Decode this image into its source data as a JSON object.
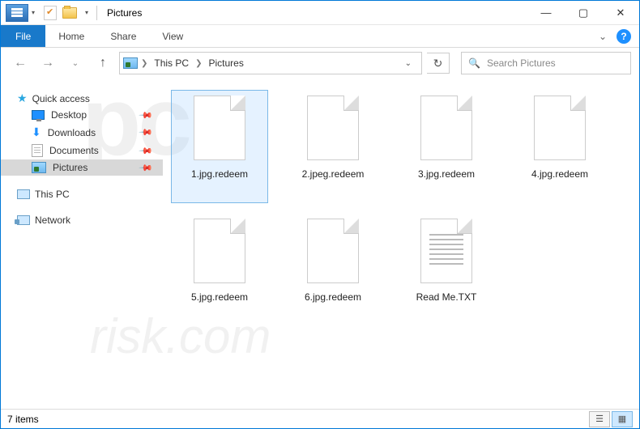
{
  "window": {
    "title": "Pictures"
  },
  "ribbon": {
    "file": "File",
    "tabs": [
      "Home",
      "Share",
      "View"
    ]
  },
  "breadcrumb": {
    "root": "This PC",
    "current": "Pictures"
  },
  "search": {
    "placeholder": "Search Pictures"
  },
  "nav": {
    "quick_access": "Quick access",
    "items": [
      {
        "label": "Desktop"
      },
      {
        "label": "Downloads"
      },
      {
        "label": "Documents"
      },
      {
        "label": "Pictures"
      }
    ],
    "this_pc": "This PC",
    "network": "Network"
  },
  "files": [
    {
      "name": "1.jpg.redeem",
      "type": "file",
      "selected": true
    },
    {
      "name": "2.jpeg.redeem",
      "type": "file",
      "selected": false
    },
    {
      "name": "3.jpg.redeem",
      "type": "file",
      "selected": false
    },
    {
      "name": "4.jpg.redeem",
      "type": "file",
      "selected": false
    },
    {
      "name": "5.jpg.redeem",
      "type": "file",
      "selected": false
    },
    {
      "name": "6.jpg.redeem",
      "type": "file",
      "selected": false
    },
    {
      "name": "Read Me.TXT",
      "type": "txt",
      "selected": false
    }
  ],
  "status": {
    "count_text": "7 items"
  }
}
